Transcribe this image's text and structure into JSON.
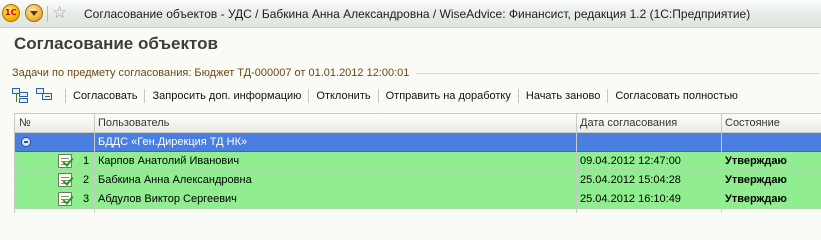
{
  "window": {
    "title": "Согласование объектов - УДС / Бабкина Анна Александровна / WiseAdvice: Финансист, редакция 1.2  (1С:Предприятие)",
    "logo_text": "1С"
  },
  "form": {
    "title": "Согласование объектов",
    "group_caption": "Задачи по предмету согласования: Бюджет ТД-000007 от 01.01.2012 12:00:01"
  },
  "toolbar": {
    "approve": "Согласовать",
    "request_info": "Запросить доп. информацию",
    "reject": "Отклонить",
    "send_back": "Отправить на доработку",
    "restart": "Начать заново",
    "approve_all": "Согласовать полностью"
  },
  "table": {
    "columns": {
      "num": "№",
      "user": "Пользователь",
      "date": "Дата согласования",
      "state": "Состояние"
    },
    "group": {
      "label": "БДДС «Ген.Дирекция ТД НК»"
    },
    "rows": [
      {
        "num": "1",
        "user": "Карпов Анатолий Иванович",
        "date": "09.04.2012 12:47:00",
        "state": "Утверждаю"
      },
      {
        "num": "2",
        "user": "Бабкина Анна Александровна",
        "date": "25.04.2012 15:04:28",
        "state": "Утверждаю"
      },
      {
        "num": "3",
        "user": "Абдулов Виктор Сергеевич",
        "date": "25.04.2012 16:10:49",
        "state": "Утверждаю"
      }
    ]
  },
  "colors": {
    "group_row": "#4a7fe0",
    "approved_row": "#90ee90"
  }
}
